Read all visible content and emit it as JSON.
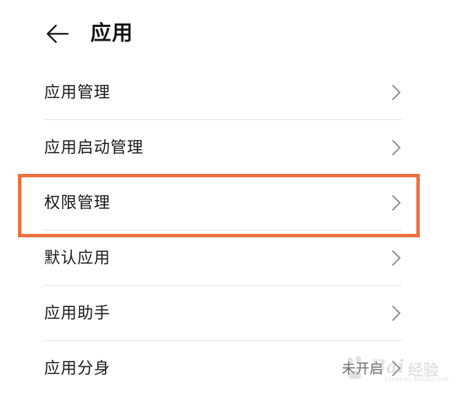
{
  "header": {
    "title": "应用",
    "back_icon": "arrow-left-icon"
  },
  "list": {
    "items": [
      {
        "label": "应用管理",
        "icon": "chevron-right-icon"
      },
      {
        "label": "应用启动管理",
        "icon": "chevron-right-icon"
      },
      {
        "label": "权限管理",
        "icon": "chevron-right-icon",
        "highlighted": true
      },
      {
        "label": "默认应用",
        "icon": "chevron-right-icon"
      },
      {
        "label": "应用助手",
        "icon": "chevron-right-icon"
      },
      {
        "label": "应用分身",
        "value": "未开启",
        "icon": "chevron-right-icon"
      }
    ]
  },
  "highlight": {
    "color": "#f0703f"
  },
  "watermark": {
    "brand": "Bai",
    "suffix": "经验",
    "sub": "jingyan.baidu.com"
  }
}
